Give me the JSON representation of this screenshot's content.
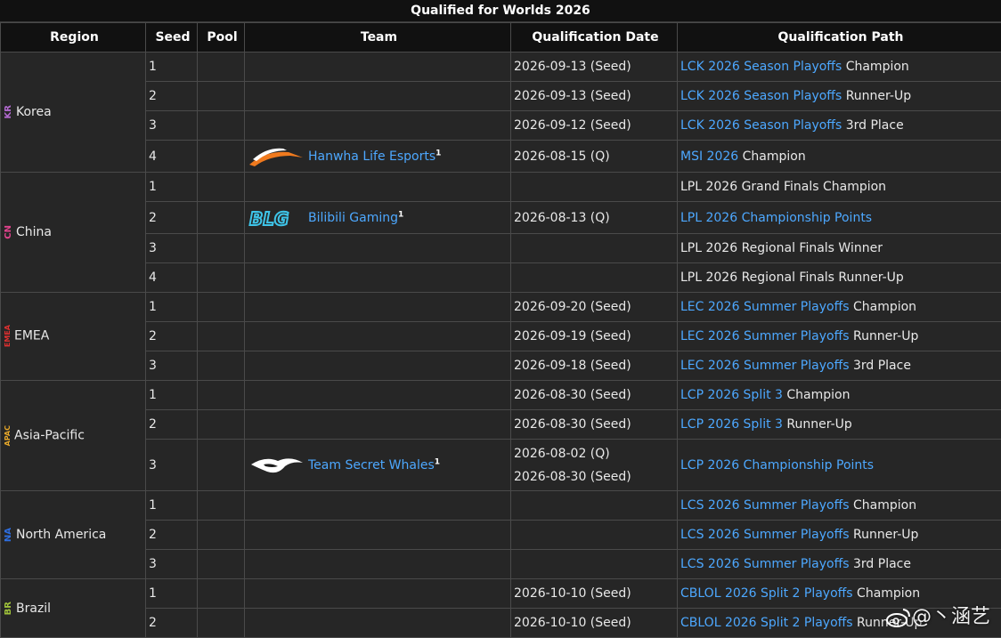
{
  "caption": "Qualified for Worlds 2026",
  "headers": [
    "Region",
    "Seed",
    "Pool",
    "Team",
    "Qualification Date",
    "Qualification Path"
  ],
  "regions": {
    "korea": {
      "code": "KR",
      "name": "Korea",
      "color": "#b36ad1"
    },
    "china": {
      "code": "CN",
      "name": "China",
      "color": "#e0428c"
    },
    "emea": {
      "code": "EMEA",
      "name": "EMEA",
      "color": "#e03030"
    },
    "apac": {
      "code": "APAC",
      "name": "Asia-Pacific",
      "color": "#e7a82a"
    },
    "na": {
      "code": "NA",
      "name": "North America",
      "color": "#2d6ee0"
    },
    "brazil": {
      "code": "BR",
      "name": "Brazil",
      "color": "#9fc23a"
    }
  },
  "teams": {
    "hle": {
      "name": "Hanwha Life Esports",
      "sup": "1",
      "logo": "hanwha-logo-icon"
    },
    "blg": {
      "name": "Bilibili Gaming",
      "sup": "1",
      "logo": "blg-logo-icon"
    },
    "tsw": {
      "name": "Team Secret Whales",
      "sup": "1",
      "logo": "team-secret-logo-icon"
    }
  },
  "rows": {
    "kr1": {
      "seed": "1",
      "date": "2026-09-13 (Seed)",
      "path_link": "LCK 2026 Season Playoffs",
      "path_text": " Champion"
    },
    "kr2": {
      "seed": "2",
      "date": "2026-09-13 (Seed)",
      "path_link": "LCK 2026 Season Playoffs",
      "path_text": " Runner-Up"
    },
    "kr3": {
      "seed": "3",
      "date": "2026-09-12 (Seed)",
      "path_link": "LCK 2026 Season Playoffs",
      "path_text": " 3rd Place"
    },
    "kr4": {
      "seed": "4",
      "date": "2026-08-15 (Q)",
      "path_link": "MSI 2026",
      "path_text": " Champion"
    },
    "cn1": {
      "seed": "1",
      "date": "",
      "path_link": "",
      "path_text": "LPL 2026 Grand Finals Champion"
    },
    "cn2": {
      "seed": "2",
      "date": "2026-08-13 (Q)",
      "path_link": "LPL 2026 Championship Points",
      "path_text": ""
    },
    "cn3": {
      "seed": "3",
      "date": "",
      "path_link": "",
      "path_text": "LPL 2026 Regional Finals Winner"
    },
    "cn4": {
      "seed": "4",
      "date": "",
      "path_link": "",
      "path_text": "LPL 2026 Regional Finals Runner-Up"
    },
    "em1": {
      "seed": "1",
      "date": "2026-09-20 (Seed)",
      "path_link": "LEC 2026 Summer Playoffs",
      "path_text": " Champion"
    },
    "em2": {
      "seed": "2",
      "date": "2026-09-19 (Seed)",
      "path_link": "LEC 2026 Summer Playoffs",
      "path_text": " Runner-Up"
    },
    "em3": {
      "seed": "3",
      "date": "2026-09-18 (Seed)",
      "path_link": "LEC 2026 Summer Playoffs",
      "path_text": " 3rd Place"
    },
    "ap1": {
      "seed": "1",
      "date": "2026-08-30 (Seed)",
      "path_link": "LCP 2026 Split 3",
      "path_text": " Champion"
    },
    "ap2": {
      "seed": "2",
      "date": "2026-08-30 (Seed)",
      "path_link": "LCP 2026 Split 3",
      "path_text": " Runner-Up"
    },
    "ap3": {
      "seed": "3",
      "date": "2026-08-02 (Q)",
      "date2": "2026-08-30 (Seed)",
      "path_link": "LCP 2026 Championship Points",
      "path_text": ""
    },
    "na1": {
      "seed": "1",
      "date": "",
      "path_link": "LCS 2026 Summer Playoffs",
      "path_text": " Champion"
    },
    "na2": {
      "seed": "2",
      "date": "",
      "path_link": "LCS 2026 Summer Playoffs",
      "path_text": " Runner-Up"
    },
    "na3": {
      "seed": "3",
      "date": "",
      "path_link": "LCS 2026 Summer Playoffs",
      "path_text": " 3rd Place"
    },
    "br1": {
      "seed": "1",
      "date": "2026-10-10 (Seed)",
      "path_link": "CBLOL 2026 Split 2 Playoffs",
      "path_text": " Champion"
    },
    "br2": {
      "seed": "2",
      "date": "2026-10-10 (Seed)",
      "path_link": "CBLOL 2026 Split 2 Playoffs",
      "path_text": " Runner-Up"
    }
  },
  "watermark": {
    "text": "@丶涵艺",
    "icon": "weibo-icon"
  }
}
